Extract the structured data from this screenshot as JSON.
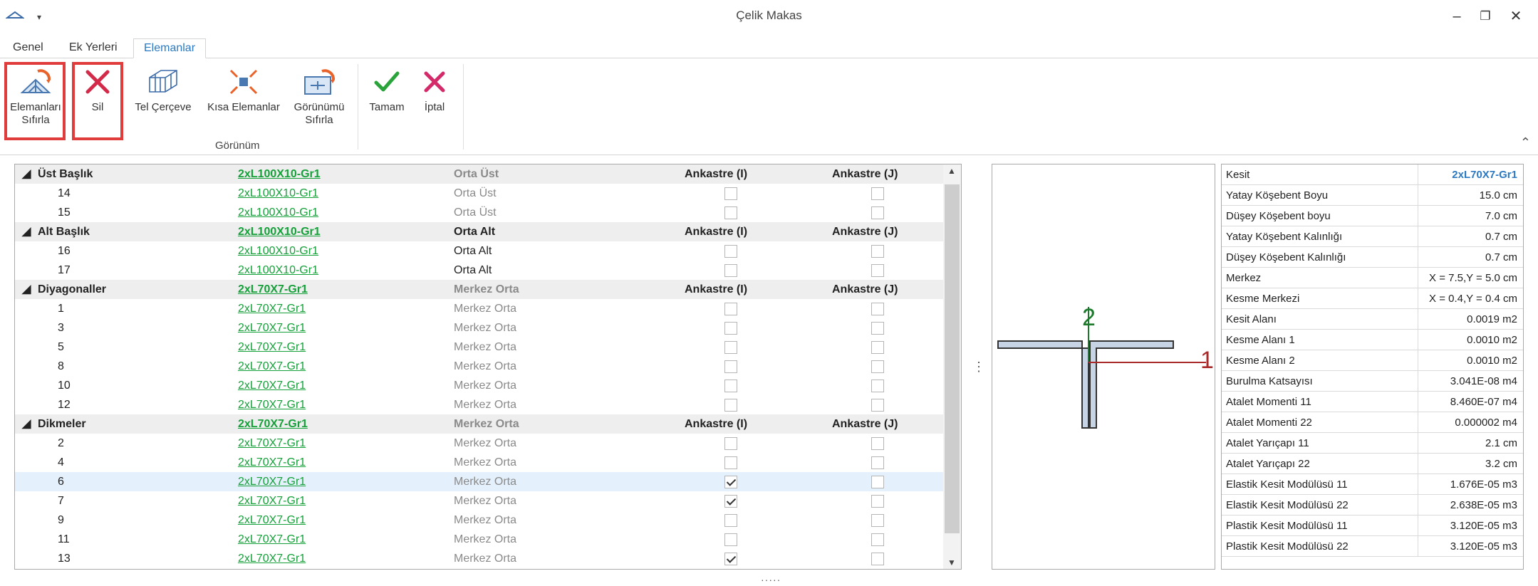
{
  "window": {
    "title": "Çelik Makas"
  },
  "tabs": [
    {
      "label": "Genel"
    },
    {
      "label": "Ek Yerleri"
    },
    {
      "label": "Elemanlar"
    }
  ],
  "ribbon": {
    "reset_elements": "Elemanları Sıfırla",
    "delete": "Sil",
    "wireframe": "Tel Çerçeve",
    "short_elements": "Kısa Elemanlar",
    "reset_view": "Görünümü Sıfırla",
    "ok": "Tamam",
    "cancel": "İptal",
    "group_view": "Görünüm"
  },
  "grid": {
    "rows": [
      {
        "type": "group",
        "name": "Üst Başlık",
        "section": "2xL100X10-Gr1",
        "position": "Orta Üst",
        "ank_i": "Ankastre (I)",
        "ank_j": "Ankastre (J)"
      },
      {
        "type": "item",
        "name": "14",
        "section": "2xL100X10-Gr1",
        "position": "Orta Üst",
        "i": false,
        "j": false
      },
      {
        "type": "item",
        "name": "15",
        "section": "2xL100X10-Gr1",
        "position": "Orta Üst",
        "i": false,
        "j": false
      },
      {
        "type": "group",
        "name": "Alt Başlık",
        "section": "2xL100X10-Gr1",
        "position": "Orta Alt",
        "ank_i": "Ankastre (I)",
        "ank_j": "Ankastre (J)"
      },
      {
        "type": "item",
        "name": "16",
        "section": "2xL100X10-Gr1",
        "position": "Orta Alt",
        "i": false,
        "j": false
      },
      {
        "type": "item",
        "name": "17",
        "section": "2xL100X10-Gr1",
        "position": "Orta Alt",
        "i": false,
        "j": false
      },
      {
        "type": "group",
        "name": "Diyagonaller",
        "section": "2xL70X7-Gr1",
        "position": "Merkez Orta",
        "ank_i": "Ankastre (I)",
        "ank_j": "Ankastre (J)"
      },
      {
        "type": "item",
        "name": "1",
        "section": "2xL70X7-Gr1",
        "position": "Merkez Orta",
        "i": false,
        "j": false
      },
      {
        "type": "item",
        "name": "3",
        "section": "2xL70X7-Gr1",
        "position": "Merkez Orta",
        "i": false,
        "j": false
      },
      {
        "type": "item",
        "name": "5",
        "section": "2xL70X7-Gr1",
        "position": "Merkez Orta",
        "i": false,
        "j": false
      },
      {
        "type": "item",
        "name": "8",
        "section": "2xL70X7-Gr1",
        "position": "Merkez Orta",
        "i": false,
        "j": false
      },
      {
        "type": "item",
        "name": "10",
        "section": "2xL70X7-Gr1",
        "position": "Merkez Orta",
        "i": false,
        "j": false
      },
      {
        "type": "item",
        "name": "12",
        "section": "2xL70X7-Gr1",
        "position": "Merkez Orta",
        "i": false,
        "j": false
      },
      {
        "type": "group",
        "name": "Dikmeler",
        "section": "2xL70X7-Gr1",
        "position": "Merkez Orta",
        "ank_i": "Ankastre (I)",
        "ank_j": "Ankastre (J)"
      },
      {
        "type": "item",
        "name": "2",
        "section": "2xL70X7-Gr1",
        "position": "Merkez Orta",
        "i": false,
        "j": false
      },
      {
        "type": "item",
        "name": "4",
        "section": "2xL70X7-Gr1",
        "position": "Merkez Orta",
        "i": false,
        "j": false
      },
      {
        "type": "item",
        "name": "6",
        "section": "2xL70X7-Gr1",
        "position": "Merkez Orta",
        "i": true,
        "j": false,
        "selected": true
      },
      {
        "type": "item",
        "name": "7",
        "section": "2xL70X7-Gr1",
        "position": "Merkez Orta",
        "i": true,
        "j": false
      },
      {
        "type": "item",
        "name": "9",
        "section": "2xL70X7-Gr1",
        "position": "Merkez Orta",
        "i": false,
        "j": false
      },
      {
        "type": "item",
        "name": "11",
        "section": "2xL70X7-Gr1",
        "position": "Merkez Orta",
        "i": false,
        "j": false
      },
      {
        "type": "item",
        "name": "13",
        "section": "2xL70X7-Gr1",
        "position": "Merkez Orta",
        "i": true,
        "j": false
      }
    ]
  },
  "drawing": {
    "axis_2": "2",
    "axis_1": "1"
  },
  "props": [
    {
      "k": "Kesit",
      "v": "2xL70X7-Gr1"
    },
    {
      "k": "Yatay Köşebent Boyu",
      "v": "15.0 cm"
    },
    {
      "k": "Düşey Köşebent boyu",
      "v": "7.0 cm"
    },
    {
      "k": "Yatay Köşebent Kalınlığı",
      "v": "0.7 cm"
    },
    {
      "k": "Düşey Köşebent Kalınlığı",
      "v": "0.7 cm"
    },
    {
      "k": "Merkez",
      "v": "X = 7.5,Y = 5.0 cm"
    },
    {
      "k": "Kesme Merkezi",
      "v": "X = 0.4,Y = 0.4 cm"
    },
    {
      "k": "Kesit Alanı",
      "v": "0.0019 m2"
    },
    {
      "k": "Kesme Alanı 1",
      "v": "0.0010 m2"
    },
    {
      "k": "Kesme Alanı 2",
      "v": "0.0010 m2"
    },
    {
      "k": "Burulma Katsayısı",
      "v": "3.041E-08 m4"
    },
    {
      "k": "Atalet Momenti 11",
      "v": "8.460E-07 m4"
    },
    {
      "k": "Atalet Momenti 22",
      "v": "0.000002 m4"
    },
    {
      "k": "Atalet Yarıçapı 11",
      "v": "2.1 cm"
    },
    {
      "k": "Atalet Yarıçapı 22",
      "v": "3.2 cm"
    },
    {
      "k": "Elastik Kesit Modülüsü 11",
      "v": "1.676E-05 m3"
    },
    {
      "k": "Elastik Kesit Modülüsü 22",
      "v": "2.638E-05 m3"
    },
    {
      "k": "Plastik Kesit Modülüsü 11",
      "v": "3.120E-05 m3"
    },
    {
      "k": "Plastik Kesit Modülüsü 22",
      "v": "3.120E-05 m3"
    }
  ],
  "colors": {
    "accent": "#2b79c2",
    "link": "#16a03a",
    "highlight": "#e03c3c"
  }
}
